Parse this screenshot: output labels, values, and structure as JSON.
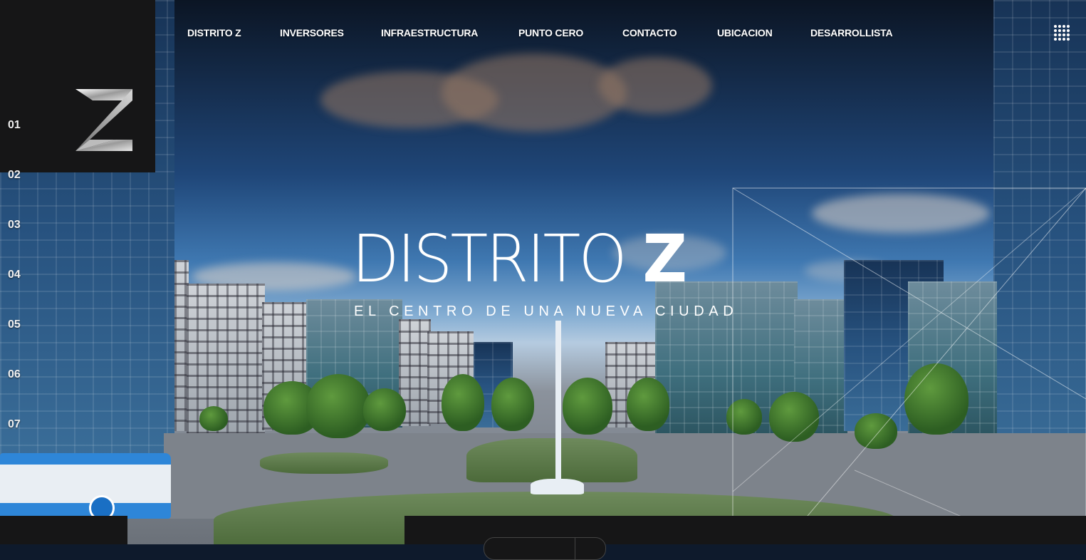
{
  "nav": {
    "items": [
      {
        "label": "DISTRITO Z"
      },
      {
        "label": "INVERSORES"
      },
      {
        "label": "INFRAESTRUCTURA"
      },
      {
        "label": "PUNTO CERO"
      },
      {
        "label": "CONTACTO"
      },
      {
        "label": "UBICACION"
      },
      {
        "label": "DESARROLLISTA"
      }
    ],
    "menu_icon": "grid-menu-icon"
  },
  "logo": {
    "icon": "distrito-z-logo"
  },
  "sections": [
    "01",
    "02",
    "03",
    "04",
    "05",
    "06",
    "07"
  ],
  "hero": {
    "title_main": "DISTRITO",
    "title_letter": "Z",
    "subtitle": "EL CENTRO DE UNA NUEVA CIUDAD"
  },
  "colors": {
    "panel": "#161617",
    "text": "#ffffff"
  }
}
